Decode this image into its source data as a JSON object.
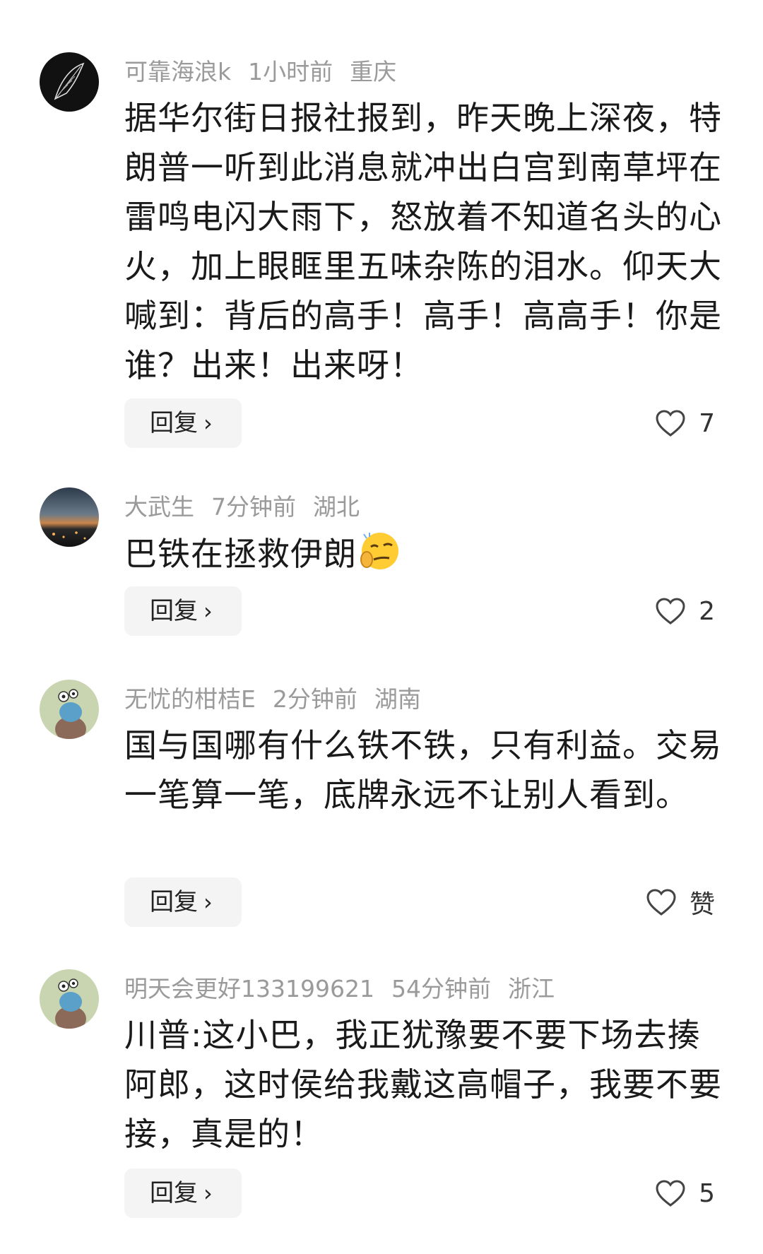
{
  "comments": [
    {
      "username": "可靠海浪k",
      "time": "1小时前",
      "location": "重庆",
      "text": "据华尔街日报社报到，昨天晚上深夜，特朗普一听到此消息就冲出白宫到南草坪在雷鸣电闪大雨下，怒放着不知道名头的心火，加上眼眶里五味杂陈的泪水。仰天大喊到：背后的高手！高手！高高手！你是谁？出来！出来呀！",
      "reply_label": "回复",
      "like_count": "7",
      "avatar_icon": "feather-avatar"
    },
    {
      "username": "大武生",
      "time": "7分钟前",
      "location": "湖北",
      "text": "巴铁在拯救伊朗",
      "emoji": "smirk-thinking-emoji",
      "reply_label": "回复",
      "like_count": "2",
      "avatar_icon": "night-landscape-avatar"
    },
    {
      "username": "无忧的柑桔E",
      "time": "2分钟前",
      "location": "湖南",
      "text": "国与国哪有什么铁不铁，只有利益。交易一笔算一笔，底牌永远不让别人看到。",
      "reply_label": "回复",
      "like_count": "赞",
      "avatar_icon": "cartoon-bird-avatar"
    },
    {
      "username": "明天会更好133199621",
      "time": "54分钟前",
      "location": "浙江",
      "text": "川普:这小巴，我正犹豫要不要下场去揍阿郎，这时侯给我戴这高帽子，我要不要接，真是的！",
      "reply_label": "回复",
      "like_count": "5",
      "avatar_icon": "cartoon-bird-avatar"
    }
  ],
  "icons": {
    "reply_chevron": "chevron-right-icon",
    "like": "heart-outline-icon"
  },
  "colors": {
    "meta_text": "#9a9a9a",
    "body_text": "#1a1a1a",
    "reply_bg": "#f4f4f4"
  }
}
